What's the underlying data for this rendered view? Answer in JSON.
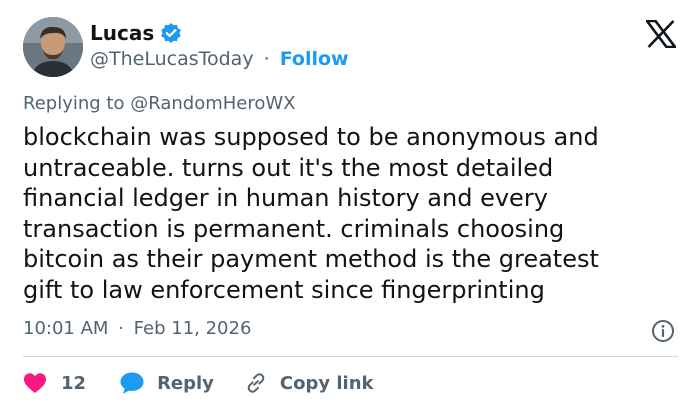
{
  "author": {
    "name": "Lucas",
    "handle": "@TheLucasToday",
    "separator": "·",
    "follow_label": "Follow",
    "avatar_icon": "avatar-photo",
    "verified_icon": "verified-badge-icon"
  },
  "platform": {
    "logo": "x-logo-icon"
  },
  "replying_to": {
    "prefix": "Replying to",
    "mention": "@RandomHeroWX"
  },
  "tweet": {
    "text": "blockchain was supposed to be anonymous and\nuntraceable. turns out it's the most detailed\nfinancial ledger in human history and every\ntransaction is permanent. criminals choosing\nbitcoin as their payment method is the greatest\ngift to law enforcement since fingerprinting"
  },
  "meta": {
    "time": "10:01 AM",
    "separator": "·",
    "date": "Feb 11, 2026"
  },
  "actions": {
    "like_count": "12",
    "reply_label": "Reply",
    "copy_link_label": "Copy link"
  },
  "colors": {
    "accent": "#1d9bf0",
    "like": "#f91880",
    "text": "#0f1419",
    "muted": "#536471",
    "divider": "#cfd9de"
  }
}
